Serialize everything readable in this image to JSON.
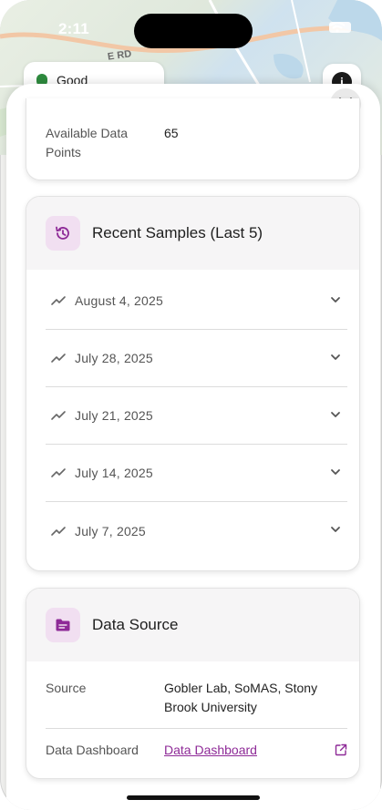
{
  "status_bar": {
    "time": "2:11"
  },
  "map": {
    "road_label": "E RD",
    "air_quality_label": "Good"
  },
  "sheet": {
    "summary": {
      "available_label": "Available Data Points",
      "available_value": "65"
    },
    "recent_samples": {
      "title": "Recent Samples (Last 5)",
      "items": [
        {
          "date": "August 4, 2025"
        },
        {
          "date": "July 28, 2025"
        },
        {
          "date": "July 21, 2025"
        },
        {
          "date": "July 14, 2025"
        },
        {
          "date": "July 7, 2025"
        }
      ]
    },
    "data_source": {
      "title": "Data Source",
      "source_label": "Source",
      "source_value": "Gobler Lab, SoMAS, Stony Brook University",
      "dashboard_label": "Data Dashboard",
      "dashboard_link": "Data Dashboard"
    }
  },
  "colors": {
    "accent": "#8e2a97",
    "icon_bg": "#f1dff1",
    "good_indicator": "#2e8b3e"
  },
  "icons": {
    "close": "close-icon",
    "history": "history-icon",
    "trend": "trending-icon",
    "expand": "chevron-down-icon",
    "folder": "folder-icon",
    "external": "external-link-icon",
    "info": "info-icon"
  }
}
